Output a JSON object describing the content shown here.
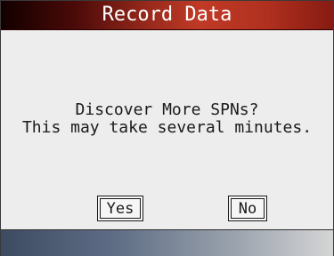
{
  "header": {
    "title": "Record Data"
  },
  "dialog": {
    "question": "Discover More SPNs?",
    "detail": "This may take several minutes.",
    "yes_label": "Yes",
    "no_label": "No"
  },
  "colors": {
    "title_accent": "#c03a26",
    "background": "#ededed",
    "status_bar": "#5f6e86"
  }
}
